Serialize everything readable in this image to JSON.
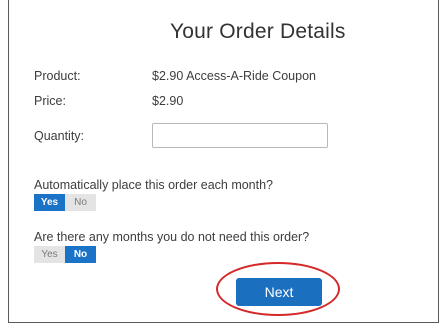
{
  "page": {
    "title": "Your Order Details"
  },
  "details": {
    "product_label": "Product:",
    "product_value": "$2.90 Access-A-Ride Coupon",
    "price_label": "Price:",
    "price_value": "$2.90",
    "quantity_label": "Quantity:",
    "quantity_value": "",
    "quantity_placeholder": ""
  },
  "auto_order": {
    "question": "Automatically place this order each month?",
    "yes_label": "Yes",
    "no_label": "No",
    "selected": "Yes"
  },
  "skip_months": {
    "question": "Are there any months you do not need this order?",
    "yes_label": "Yes",
    "no_label": "No",
    "selected": "No"
  },
  "actions": {
    "next_label": "Next"
  },
  "colors": {
    "accent": "#1b6fbf",
    "toggle_on": "#1a73c7",
    "toggle_off": "#e4e4e4",
    "highlight": "#d62828"
  }
}
